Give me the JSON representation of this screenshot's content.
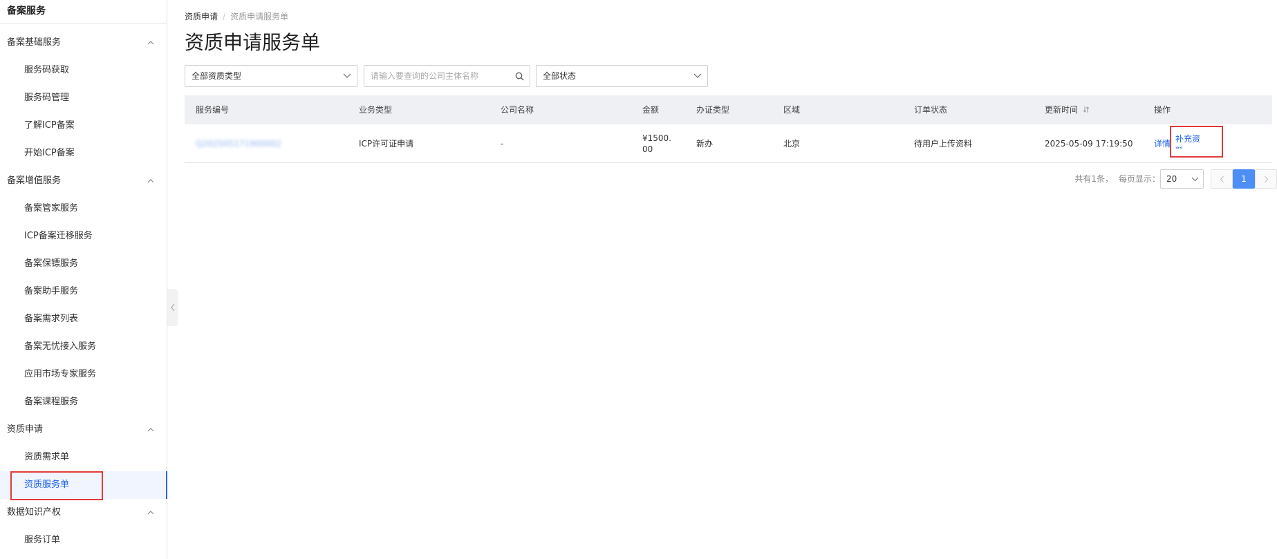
{
  "sidebar": {
    "title": "备案服务",
    "groups": [
      {
        "label": "备案基础服务",
        "items": [
          {
            "label": "服务码获取"
          },
          {
            "label": "服务码管理"
          },
          {
            "label": "了解ICP备案"
          },
          {
            "label": "开始ICP备案"
          }
        ]
      },
      {
        "label": "备案增值服务",
        "items": [
          {
            "label": "备案管家服务"
          },
          {
            "label": "ICP备案迁移服务"
          },
          {
            "label": "备案保镖服务"
          },
          {
            "label": "备案助手服务"
          },
          {
            "label": "备案需求列表"
          },
          {
            "label": "备案无忧接入服务"
          },
          {
            "label": "应用市场专家服务"
          },
          {
            "label": "备案课程服务"
          }
        ]
      },
      {
        "label": "资质申请",
        "items": [
          {
            "label": "资质需求单"
          },
          {
            "label": "资质服务单"
          }
        ]
      },
      {
        "label": "数据知识产权",
        "items": [
          {
            "label": "服务订单"
          }
        ]
      }
    ]
  },
  "breadcrumb": {
    "parent": "资质申请",
    "separator": "/",
    "current": "资质申请服务单"
  },
  "page_title": "资质申请服务单",
  "filters": {
    "type_select": "全部资质类型",
    "search_placeholder": "请输入要查询的公司主体名称",
    "status_select": "全部状态"
  },
  "table": {
    "headers": {
      "service_no": "服务编号",
      "biz_type": "业务类型",
      "company": "公司名称",
      "amount": "金额",
      "license_type": "办证类型",
      "region": "区域",
      "order_status": "订单状态",
      "update_time": "更新时间",
      "actions": "操作"
    },
    "rows": [
      {
        "service_no": "Q202505171900002",
        "biz_type": "ICP许可证申请",
        "company": "-",
        "amount_line1": "¥1500.",
        "amount_line2": "00",
        "license_type": "新办",
        "region": "北京",
        "order_status": "待用户上传资料",
        "update_time": "2025-05-09 17:19:50",
        "action_detail": "详情",
        "action_supplement": "补充资料"
      }
    ]
  },
  "pagination": {
    "total_text": "共有1条，",
    "page_size_label": "每页显示：",
    "page_size": "20",
    "current_page": "1"
  },
  "colors": {
    "accent": "#1e63e8",
    "highlight_box": "#e23a3a",
    "page_active": "#4d8ef7"
  }
}
